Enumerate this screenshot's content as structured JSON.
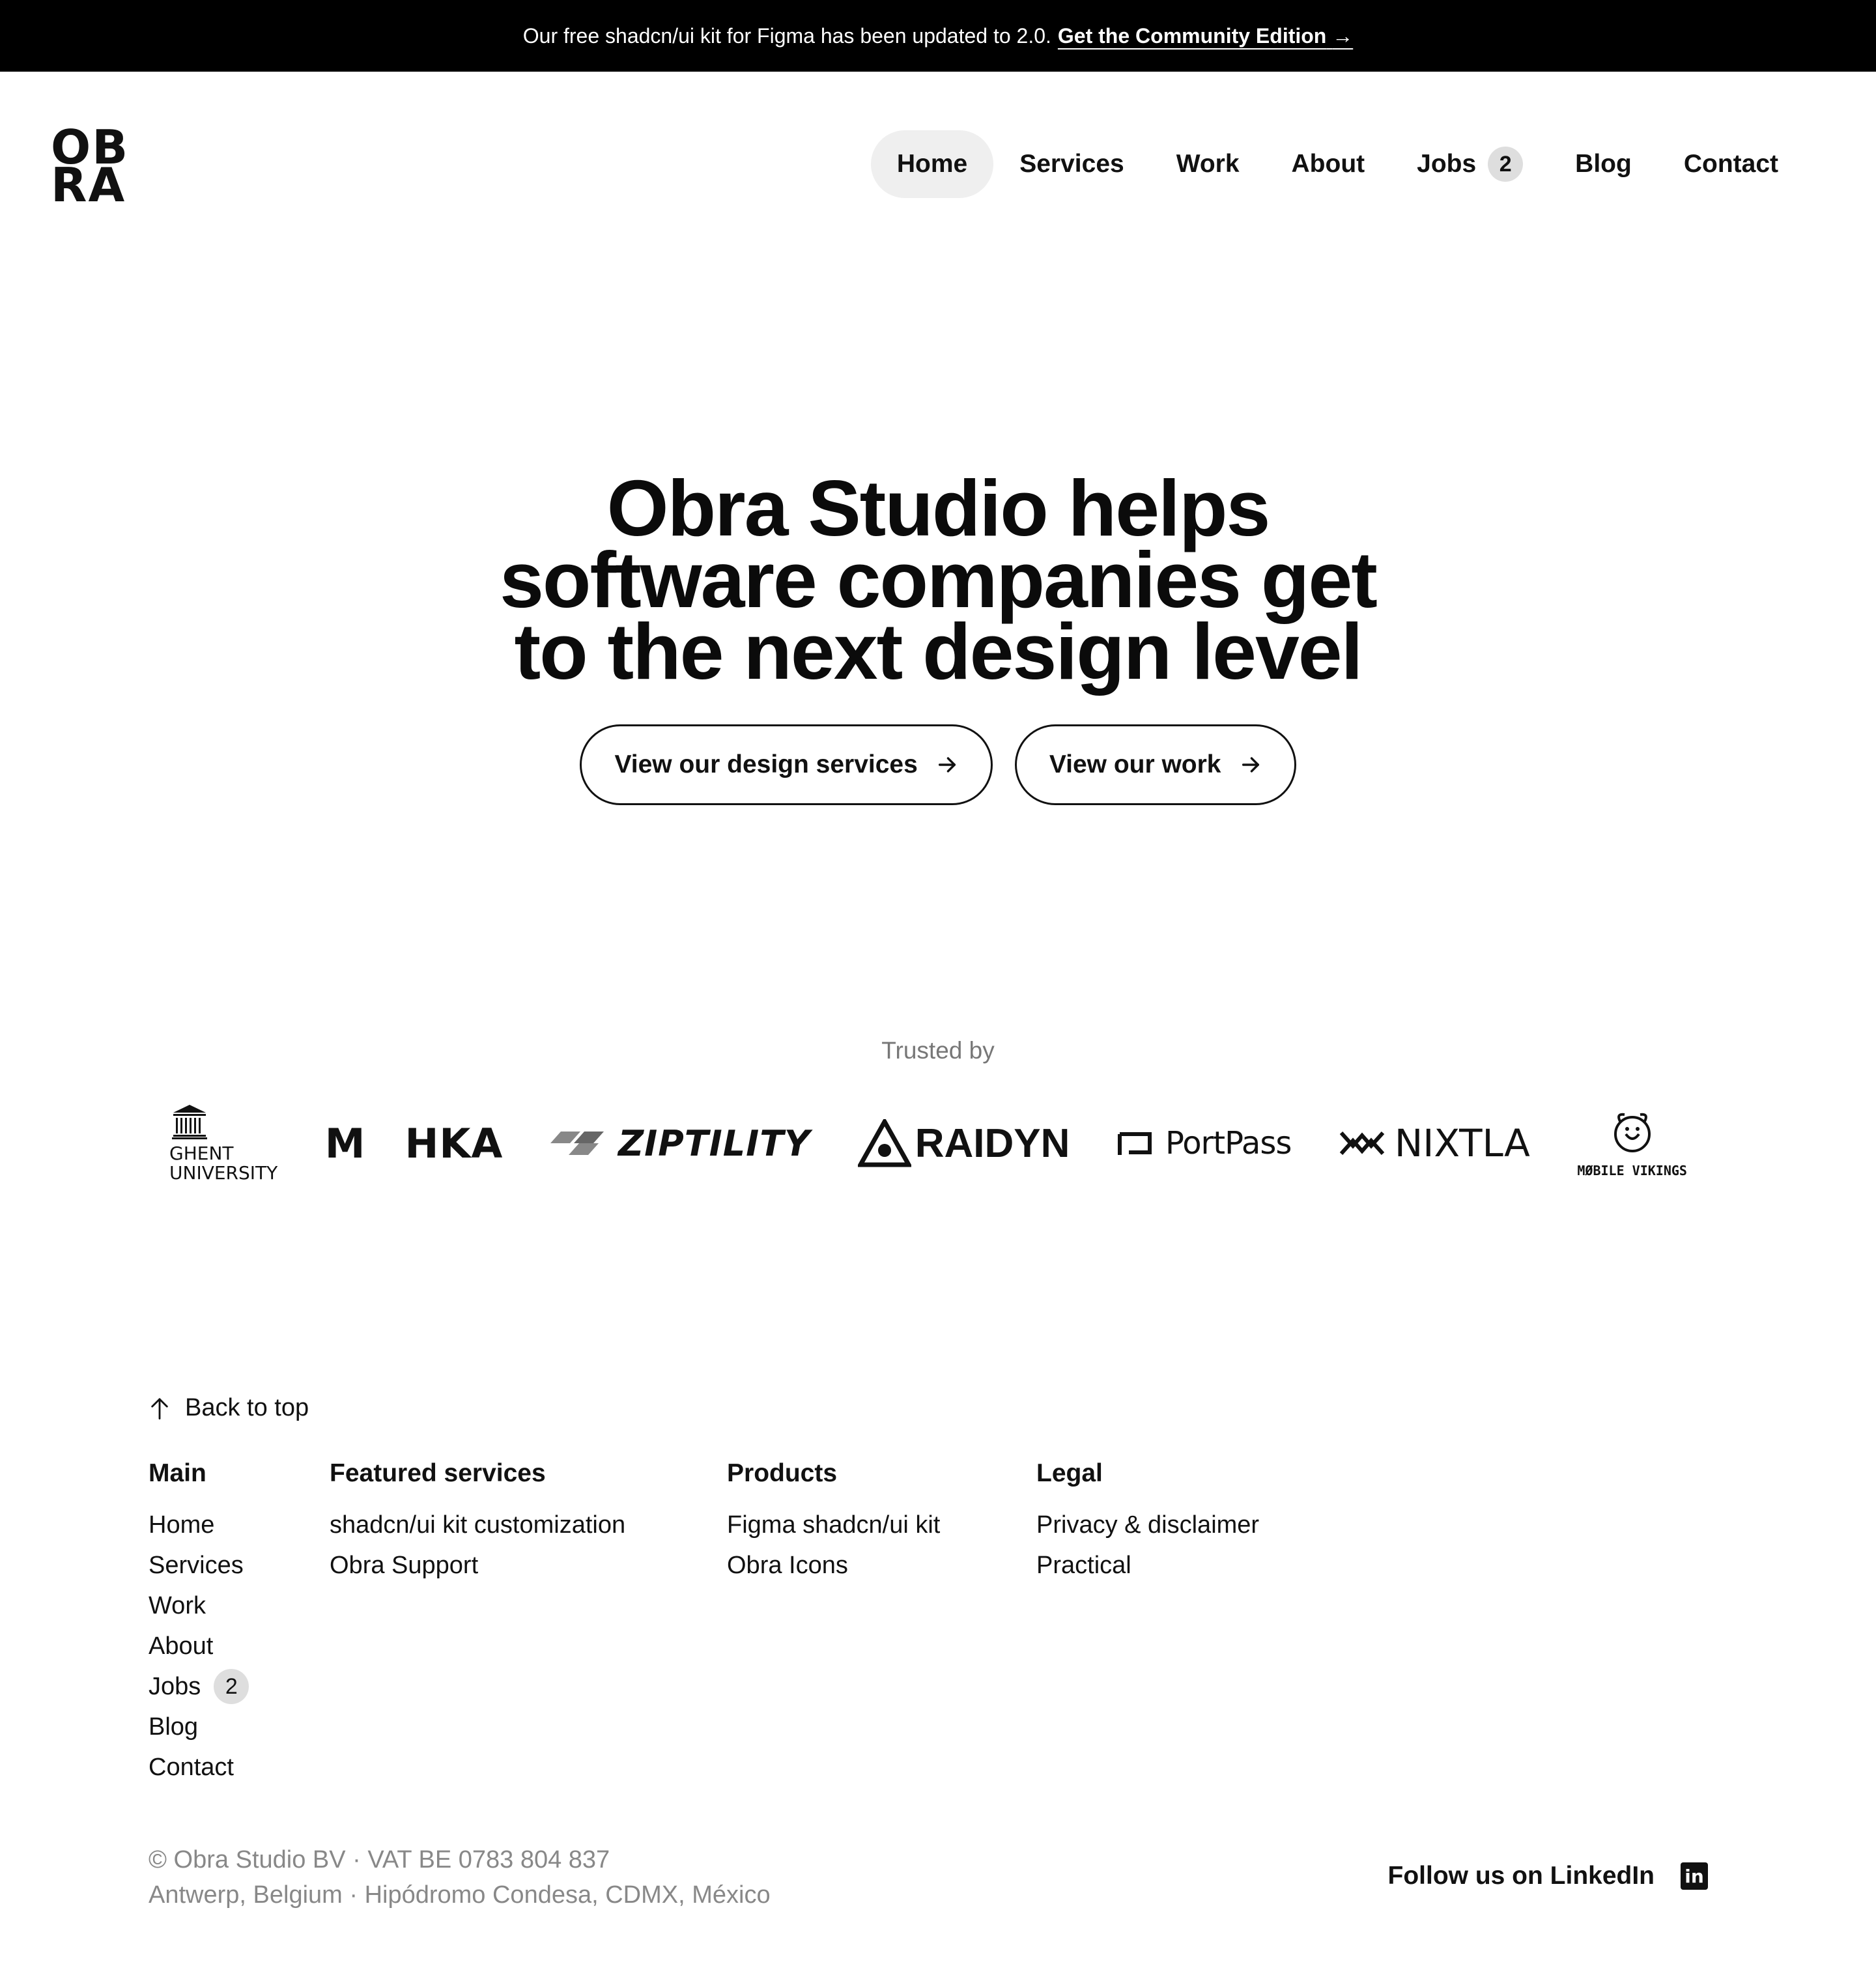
{
  "announcement": {
    "text": "Our free shadcn/ui kit for Figma has been updated to 2.0.",
    "link": "Get the Community Edition",
    "arrow": "→"
  },
  "logo": {
    "line1": "OB",
    "line2": "RA"
  },
  "nav": {
    "home": "Home",
    "services": "Services",
    "work": "Work",
    "about": "About",
    "jobs": "Jobs",
    "jobs_count": "2",
    "blog": "Blog",
    "contact": "Contact"
  },
  "hero": {
    "line1": "Obra Studio helps",
    "line2": "software companies get",
    "line3": "to the next design level",
    "cta_services": "View our design services",
    "cta_work": "View our work"
  },
  "trusted": {
    "label": "Trusted by",
    "ghent_line1": "GHENT",
    "ghent_line2": "UNIVERSITY",
    "mhka_left": "M",
    "mhka_right": "HKA",
    "ziptility": "ZIPTILITY",
    "raidyn": "RAIDYN",
    "portpass": "PortPass",
    "nixtla": "NIXTLA",
    "mobile_vikings": "MØBILE VIKINGS"
  },
  "footer": {
    "back_to_top": "Back to top",
    "main": {
      "heading": "Main",
      "home": "Home",
      "services": "Services",
      "work": "Work",
      "about": "About",
      "jobs": "Jobs",
      "jobs_count": "2",
      "blog": "Blog",
      "contact": "Contact"
    },
    "featured": {
      "heading": "Featured services",
      "items": [
        "shadcn/ui kit customization",
        "Obra Support"
      ]
    },
    "products": {
      "heading": "Products",
      "items": [
        "Figma shadcn/ui kit",
        "Obra Icons"
      ]
    },
    "legal": {
      "heading": "Legal",
      "items": [
        "Privacy & disclaimer",
        "Practical"
      ]
    },
    "copyright": "© Obra Studio BV · VAT BE 0783 804 837",
    "address": "Antwerp, Belgium · Hipódromo Condesa, CDMX, México",
    "linkedin": "Follow us on LinkedIn",
    "linkedin_icon": "in"
  },
  "colors": {
    "accent_bg": "#000000",
    "nav_active": "#efefef",
    "badge": "#dedede",
    "muted_text": "#888888"
  }
}
